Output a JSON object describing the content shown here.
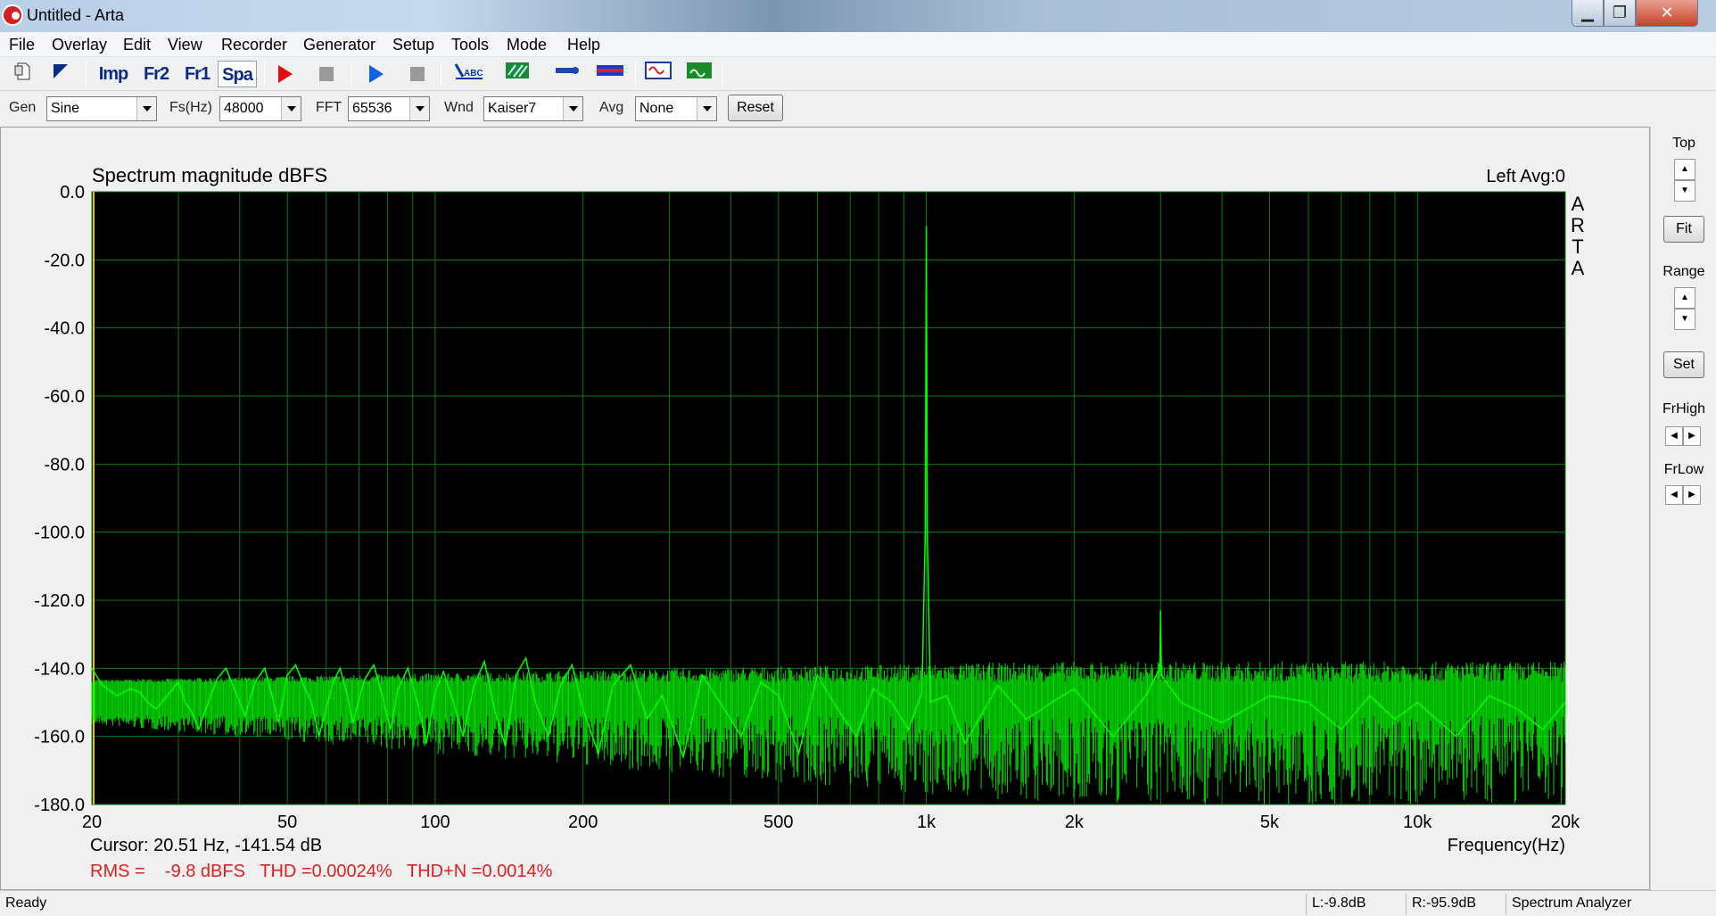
{
  "window": {
    "title": "Untitled - Arta",
    "minimize": "▁",
    "maximize": "❐",
    "close": "✕"
  },
  "menu": [
    "File",
    "Overlay",
    "Edit",
    "View",
    "Recorder",
    "Generator",
    "Setup",
    "Tools",
    "Mode",
    "Help"
  ],
  "toolbar": {
    "imp": "Imp",
    "fr2": "Fr2",
    "fr1": "Fr1",
    "spa": "Spa",
    "icons": [
      "new-file-icon",
      "open-file-icon",
      "imp-mode-icon",
      "fr2-mode-icon",
      "fr1-mode-icon",
      "spa-mode-icon",
      "record-play-icon",
      "record-stop-icon",
      "generator-play-icon",
      "generator-stop-icon",
      "abc-text-icon",
      "color-icon",
      "meter-icon",
      "bar-icon",
      "oscilloscope-icon",
      "spectrum-icon"
    ]
  },
  "params": {
    "gen_label": "Gen",
    "gen_value": "Sine",
    "fs_label": "Fs(Hz)",
    "fs_value": "48000",
    "fft_label": "FFT",
    "fft_value": "65536",
    "wnd_label": "Wnd",
    "wnd_value": "Kaiser7",
    "avg_label": "Avg",
    "avg_value": "None",
    "reset_label": "Reset"
  },
  "chart_data": {
    "type": "line",
    "title": "Spectrum magnitude dBFS",
    "channel_info": "Left  Avg:0",
    "brand_letters": [
      "A",
      "R",
      "T",
      "A"
    ],
    "xlabel": "Frequency(Hz)",
    "ylabel": "",
    "x_scale": "log",
    "xlim": [
      20,
      20000
    ],
    "ylim": [
      -180,
      0
    ],
    "x_ticks": [
      {
        "value": 20,
        "label": "20"
      },
      {
        "value": 50,
        "label": "50"
      },
      {
        "value": 100,
        "label": "100"
      },
      {
        "value": 200,
        "label": "200"
      },
      {
        "value": 500,
        "label": "500"
      },
      {
        "value": 1000,
        "label": "1k"
      },
      {
        "value": 2000,
        "label": "2k"
      },
      {
        "value": 5000,
        "label": "5k"
      },
      {
        "value": 10000,
        "label": "10k"
      },
      {
        "value": 20000,
        "label": "20k"
      }
    ],
    "y_ticks": [
      {
        "value": 0,
        "label": "0.0"
      },
      {
        "value": -20,
        "label": "-20.0"
      },
      {
        "value": -40,
        "label": "-40.0"
      },
      {
        "value": -60,
        "label": "-60.0"
      },
      {
        "value": -80,
        "label": "-80.0"
      },
      {
        "value": -100,
        "label": "-100.0"
      },
      {
        "value": -120,
        "label": "-120.0"
      },
      {
        "value": -140,
        "label": "-140.0"
      },
      {
        "value": -160,
        "label": "-160.0"
      },
      {
        "value": -180,
        "label": "-180.0"
      }
    ],
    "grid": true,
    "background": "#000000",
    "line_color": "#00ff00",
    "grid_color": "#0a7a0a",
    "noise_floor_db": -148,
    "series": [
      {
        "values_x": [
          20,
          21,
          22.5,
          24,
          25,
          26,
          27,
          28.5,
          30,
          31,
          32,
          33,
          34.5,
          36,
          37.5,
          39,
          41,
          43,
          45,
          46.5,
          48,
          50,
          52,
          54,
          56,
          58,
          60,
          62,
          64,
          66,
          68,
          70,
          72,
          75,
          78,
          81,
          84,
          88,
          92,
          96,
          100,
          104,
          109,
          114,
          120,
          126,
          132,
          139,
          146,
          153,
          160,
          170,
          180,
          190,
          200,
          215,
          230,
          250,
          270,
          290,
          320,
          350,
          380,
          420,
          460,
          500,
          550,
          600,
          660,
          720,
          780,
          850,
          920,
          980,
          995,
          1000,
          1005,
          1020,
          1100,
          1200,
          1400,
          1600,
          1800,
          2000,
          2400,
          2800,
          2990,
          3000,
          3010,
          3300,
          4000,
          5000,
          6000,
          7000,
          8000,
          9000,
          10000,
          12000,
          14000,
          16000,
          18000,
          20000
        ],
        "values_y": [
          -140,
          -145,
          -148,
          -146,
          -147,
          -150,
          -152,
          -148,
          -144,
          -150,
          -153,
          -158,
          -150,
          -143,
          -140,
          -146,
          -154,
          -144,
          -140,
          -148,
          -156,
          -142,
          -139,
          -145,
          -150,
          -160,
          -152,
          -144,
          -140,
          -147,
          -156,
          -149,
          -143,
          -139,
          -148,
          -158,
          -146,
          -140,
          -150,
          -162,
          -147,
          -141,
          -150,
          -160,
          -145,
          -138,
          -152,
          -163,
          -142,
          -137,
          -150,
          -160,
          -145,
          -139,
          -152,
          -165,
          -145,
          -139,
          -155,
          -148,
          -166,
          -142,
          -150,
          -160,
          -144,
          -148,
          -165,
          -142,
          -152,
          -160,
          -146,
          -150,
          -158,
          -147,
          -100,
          -10,
          -102,
          -150,
          -148,
          -162,
          -145,
          -155,
          -150,
          -146,
          -160,
          -148,
          -140,
          -123,
          -142,
          -150,
          -156,
          -148,
          -150,
          -158,
          -148,
          -155,
          -150,
          -160,
          -148,
          -152,
          -158,
          -150
        ]
      }
    ],
    "cursor_text": "Cursor: 20.51 Hz, -141.54 dB",
    "summary_text": "RMS =    -9.8 dBFS   THD =0.00024%   THD+N =0.0014%"
  },
  "side_panel": {
    "top": "Top",
    "fit": "Fit",
    "range": "Range",
    "set": "Set",
    "frhigh": "FrHigh",
    "frlow": "FrLow"
  },
  "status": {
    "ready": "Ready",
    "left": "L:-9.8dB",
    "right": "R:-95.9dB",
    "mode": "Spectrum Analyzer"
  }
}
